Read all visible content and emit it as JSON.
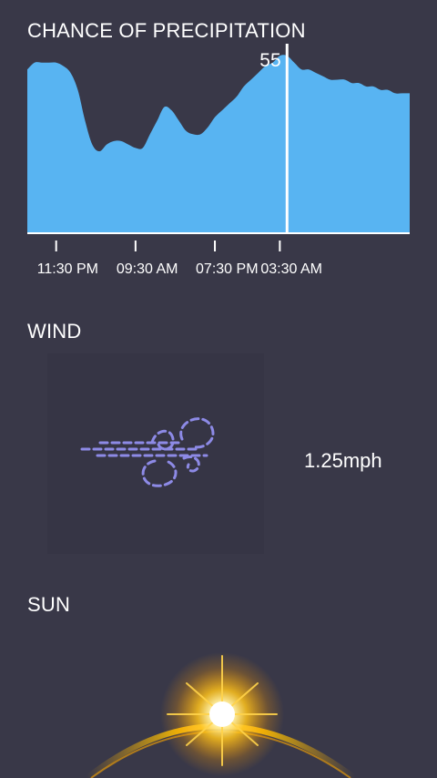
{
  "precipitation": {
    "title": "CHANCE OF PRECIPITATION",
    "current_value_label": "55"
  },
  "chart_data": {
    "type": "area",
    "x": [
      0,
      1,
      2,
      3,
      4,
      5,
      6,
      7,
      8,
      9,
      10,
      11,
      12,
      13,
      14,
      15,
      16,
      17,
      18,
      19,
      20,
      21,
      22,
      23,
      24,
      25,
      26,
      27,
      28,
      29,
      30,
      31,
      32,
      33,
      34,
      35,
      36,
      37,
      38,
      39,
      40,
      41,
      42,
      43,
      44,
      45,
      46,
      47,
      48,
      49,
      50,
      51,
      52,
      53
    ],
    "values": [
      48,
      50,
      50,
      50,
      50,
      49,
      47,
      42,
      33,
      26,
      24,
      26,
      27,
      27,
      26,
      25,
      25,
      29,
      33,
      37,
      36,
      33,
      30,
      29,
      29,
      31,
      34,
      36,
      38,
      40,
      43,
      45,
      47,
      49,
      50,
      52,
      52,
      50,
      48,
      48,
      47,
      46,
      45,
      45,
      45,
      44,
      44,
      43,
      43,
      42,
      42,
      41,
      41,
      41
    ],
    "indicator_index": 36,
    "ylim": [
      0,
      55
    ],
    "x_tick_labels": [
      "11:30 PM",
      "09:30 AM",
      "07:30 PM",
      "03:30 AM"
    ],
    "x_tick_indices": [
      4,
      15,
      26,
      35
    ],
    "fill_color": "#58b4f2",
    "axis_color": "#ffffff"
  },
  "wind": {
    "title": "WIND",
    "speed": "1.25mph",
    "icon": "wind-icon",
    "icon_color": "#8d8ae6"
  },
  "sun": {
    "title": "SUN",
    "art": "sunrise-icon",
    "glow_color": "#ffc21a"
  }
}
